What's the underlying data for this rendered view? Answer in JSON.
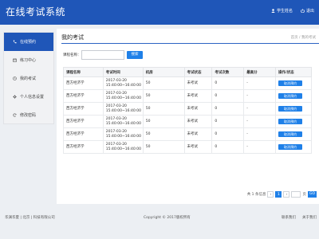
{
  "header": {
    "title": "在线考试系统",
    "user_label": "学生姓名",
    "logout_label": "退出"
  },
  "sidebar": {
    "items": [
      {
        "label": "在线预约",
        "icon": "phone-icon",
        "active": true
      },
      {
        "label": "练习中心",
        "icon": "calendar-icon",
        "active": false
      },
      {
        "label": "我的考试",
        "icon": "clock-icon",
        "active": false
      },
      {
        "label": "个人信息设置",
        "icon": "gear-icon",
        "active": false
      },
      {
        "label": "修改密码",
        "icon": "refresh-icon",
        "active": false
      }
    ]
  },
  "main": {
    "title": "我的考试",
    "breadcrumb": "首页 / 我的考试",
    "search": {
      "label": "课程名称：",
      "value": "",
      "placeholder": "",
      "button": "搜索"
    },
    "table": {
      "headers": [
        "课程名称",
        "考试时间",
        "机房",
        "考试状态",
        "考试次数",
        "最高分",
        "操作/状态"
      ],
      "rows": [
        {
          "course": "西方经济学",
          "date": "2017-03-20",
          "time": "15:40:00~16:40:00",
          "room": "50",
          "status": "未考试",
          "count": "0",
          "score": "-",
          "action": "取消预约"
        },
        {
          "course": "西方经济学",
          "date": "2017-03-20",
          "time": "15:40:00~16:40:00",
          "room": "50",
          "status": "未考试",
          "count": "0",
          "score": "-",
          "action": "取消预约"
        },
        {
          "course": "西方经济学",
          "date": "2017-03-20",
          "time": "15:40:00~16:40:00",
          "room": "50",
          "status": "未考试",
          "count": "0",
          "score": "-",
          "action": "取消预约"
        },
        {
          "course": "西方经济学",
          "date": "2017-03-20",
          "time": "15:40:00~16:40:00",
          "room": "50",
          "status": "未考试",
          "count": "0",
          "score": "-",
          "action": "取消预约"
        },
        {
          "course": "西方经济学",
          "date": "2017-03-20",
          "time": "15:40:00~16:40:00",
          "room": "50",
          "status": "未考试",
          "count": "0",
          "score": "-",
          "action": "取消预约"
        },
        {
          "course": "西方经济学",
          "date": "2017-03-20",
          "time": "15:40:00~16:40:00",
          "room": "50",
          "status": "未考试",
          "count": "0",
          "score": "-",
          "action": "取消预约"
        }
      ]
    },
    "pagination": {
      "summary": "共 1 条信息",
      "prev": "‹",
      "current": "1",
      "next": "›",
      "page_suffix": "页",
      "go": "GO"
    }
  },
  "footer": {
    "left": "华渊华夏 | 北京 | 科技有限公司",
    "center": "Copyright © 2017版权所有",
    "links": [
      "联系我们",
      "关于我们"
    ]
  },
  "colors": {
    "primary": "#1f56b8",
    "button": "#1f80e8",
    "background": "#eceff3"
  }
}
